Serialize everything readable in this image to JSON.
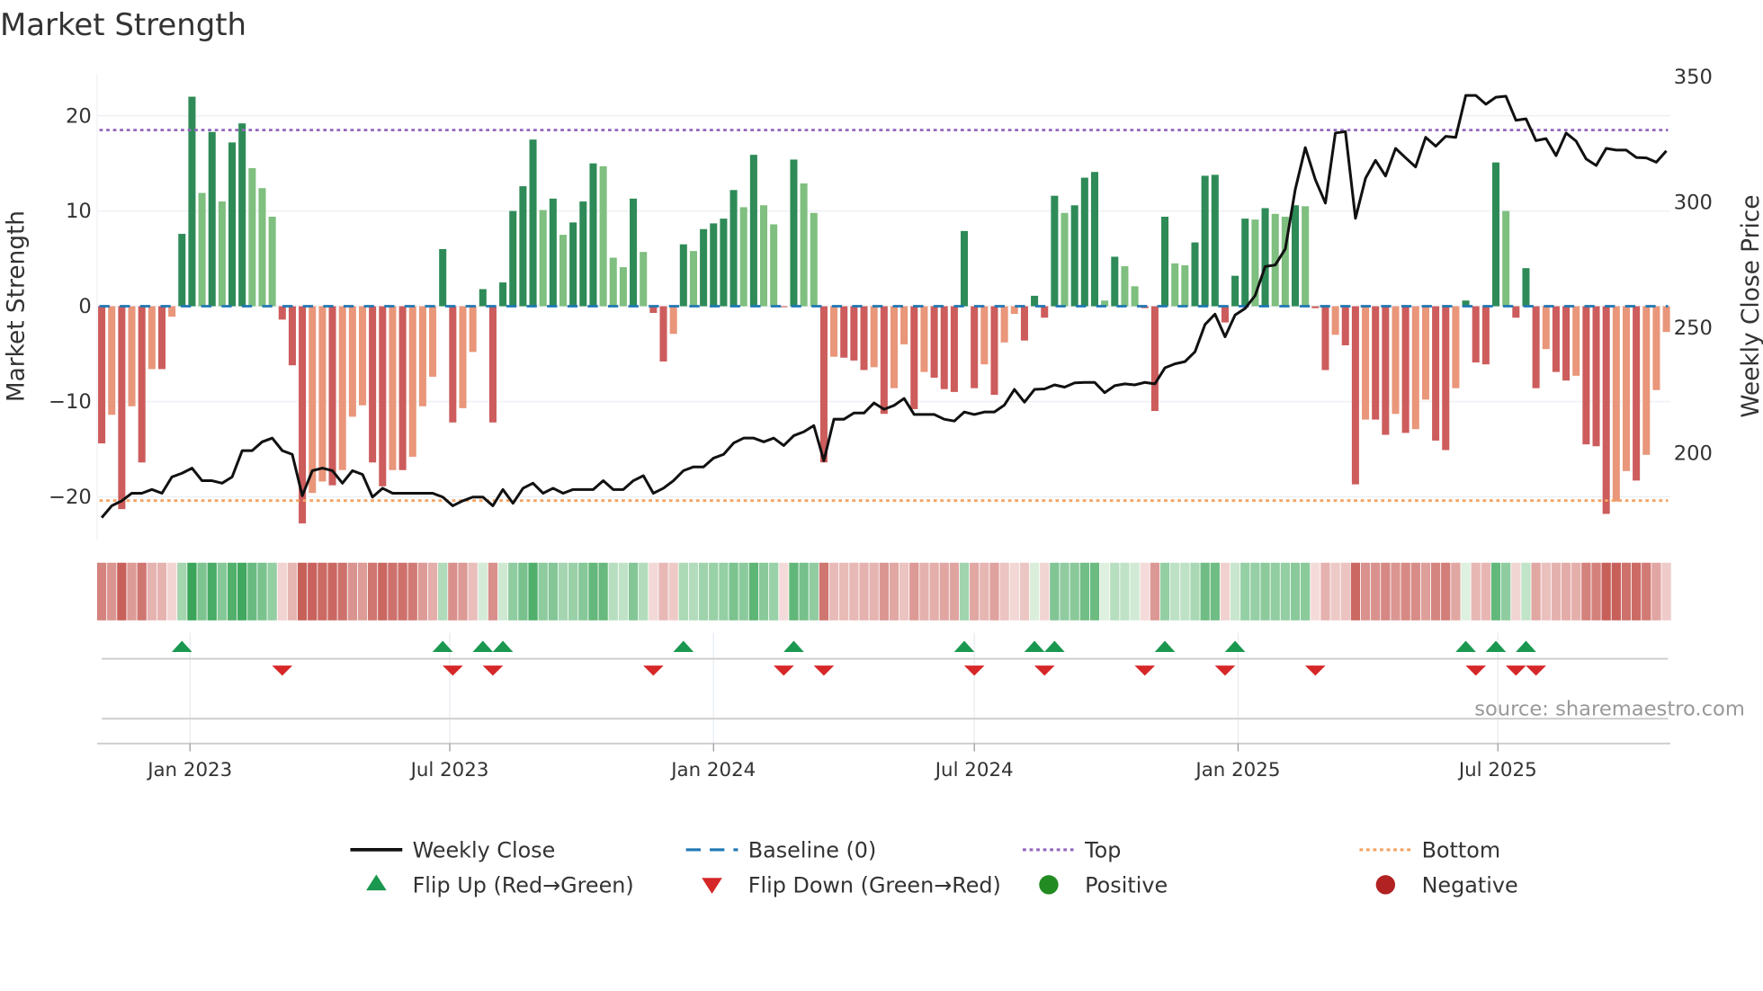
{
  "chart_data": {
    "type": "bar",
    "title": "Market Strength",
    "ylabel": "Market Strength",
    "y2label": "Weekly Close Price",
    "ylim": [
      -24.5,
      24.5
    ],
    "y2lim": [
      165.3,
      351.3
    ],
    "yticks": [
      20,
      10,
      0,
      -10,
      -20
    ],
    "ytick_labels": [
      "20",
      "10",
      "0",
      "−10",
      "−20"
    ],
    "y2ticks": [
      350,
      300,
      250,
      200
    ],
    "y2tick_labels": [
      "350",
      "300",
      "250",
      "200"
    ],
    "xticks": [
      {
        "label": "Jan 2023",
        "week_index": 8.8
      },
      {
        "label": "Jul 2023",
        "week_index": 34.7
      },
      {
        "label": "Jan 2024",
        "week_index": 61.0
      },
      {
        "label": "Jul 2024",
        "week_index": 87.0
      },
      {
        "label": "Jan 2025",
        "week_index": 113.3
      },
      {
        "label": "Jul 2025",
        "week_index": 139.2
      }
    ],
    "grid": true,
    "top_level": 18.5,
    "bottom_level": -20.4,
    "baseline": 0,
    "strength": [
      -14.4,
      -11.4,
      -21.3,
      -10.5,
      -16.4,
      -6.6,
      -6.6,
      -1.1,
      7.6,
      22.0,
      11.9,
      18.3,
      11.0,
      17.2,
      19.2,
      14.5,
      12.4,
      9.4,
      -1.4,
      -6.2,
      -22.8,
      -19.6,
      -18.4,
      -18.8,
      -17.2,
      -11.6,
      -10.4,
      -16.4,
      -18.9,
      -17.2,
      -17.2,
      -15.8,
      -10.5,
      -7.4,
      6.0,
      -12.2,
      -10.7,
      -4.8,
      1.8,
      -12.2,
      2.5,
      10.0,
      12.6,
      17.5,
      10.1,
      11.3,
      7.5,
      8.8,
      11.0,
      15.0,
      14.7,
      5.1,
      4.1,
      11.3,
      5.7,
      -0.7,
      -5.8,
      -2.9,
      6.5,
      5.8,
      8.1,
      8.7,
      9.2,
      12.2,
      10.4,
      15.9,
      10.6,
      8.6,
      -0.1,
      15.4,
      12.9,
      9.8,
      -16.4,
      -5.3,
      -5.4,
      -5.7,
      -6.7,
      -6.4,
      -11.3,
      -8.6,
      -4.0,
      -10.8,
      -6.9,
      -7.5,
      -8.7,
      -9.0,
      7.9,
      -8.6,
      -6.1,
      -9.3,
      -3.8,
      -0.8,
      -3.6,
      1.1,
      -1.2,
      11.6,
      9.8,
      10.6,
      13.5,
      14.1,
      0.6,
      5.2,
      4.2,
      2.1,
      -0.2,
      -11.0,
      9.4,
      4.5,
      4.3,
      6.7,
      13.7,
      13.8,
      -1.7,
      3.2,
      9.2,
      9.1,
      10.3,
      9.7,
      9.4,
      10.6,
      10.5,
      -0.2,
      -6.7,
      -3.0,
      -4.1,
      -18.7,
      -11.9,
      -11.9,
      -13.5,
      -11.3,
      -13.3,
      -12.9,
      -9.8,
      -14.1,
      -15.1,
      -8.6,
      0.6,
      -5.9,
      -6.1,
      15.1,
      10.0,
      -1.2,
      4.0,
      -8.6,
      -4.5,
      -6.9,
      -7.8,
      -7.3,
      -14.5,
      -14.7,
      -21.8,
      -20.5,
      -17.3,
      -18.3,
      -15.6,
      -8.8,
      -2.7
    ],
    "weekly_close": [
      174.3,
      179,
      181,
      184,
      184,
      185.5,
      184,
      190.5,
      192,
      194,
      189,
      189,
      188,
      190.5,
      201,
      201,
      204.5,
      206,
      201,
      199.5,
      183,
      193,
      194,
      193,
      188,
      193,
      191.5,
      182.5,
      186,
      184,
      184,
      184,
      184,
      184,
      182.5,
      179,
      181,
      182.5,
      182.5,
      179,
      185.5,
      180,
      186,
      188,
      184,
      186,
      184,
      185.5,
      185.5,
      185.5,
      189,
      185.5,
      185.5,
      189,
      191,
      184,
      186,
      189,
      193,
      194.5,
      194.5,
      198,
      199.5,
      204,
      206,
      206,
      204.5,
      206,
      203,
      207,
      208.5,
      211,
      197,
      213.5,
      213.5,
      216,
      216,
      220,
      217.5,
      219,
      221.8,
      215.4,
      215.4,
      215.4,
      213.5,
      212.8,
      216.4,
      215.4,
      216.4,
      216.4,
      219.2,
      225.4,
      220.3,
      225.4,
      225.6,
      227.2,
      226.3,
      228,
      228.2,
      228.2,
      224.1,
      226.9,
      227.6,
      227.2,
      228.2,
      227.6,
      234,
      235.6,
      236.5,
      240.4,
      251.3,
      255.4,
      246.4,
      255.1,
      257.7,
      262.8,
      274.4,
      275,
      281.4,
      305.1,
      321.8,
      309,
      299.7,
      327.6,
      328.2,
      293.6,
      309.6,
      316.7,
      310.5,
      321.5,
      317.7,
      314.1,
      325.9,
      322.4,
      326.3,
      325.9,
      342.6,
      342.6,
      339.1,
      341.9,
      342.3,
      332.7,
      333.3,
      324.6,
      325.4,
      318.6,
      327.6,
      324.4,
      317.3,
      314.7,
      321.5,
      320.8,
      320.8,
      317.9,
      317.7,
      316,
      320.5
    ],
    "legend_position": "bottom",
    "legend": [
      {
        "label": "Weekly Close",
        "kind": "line",
        "color": "#111111"
      },
      {
        "label": "Baseline (0)",
        "kind": "dash",
        "color": "#1f77b4"
      },
      {
        "label": "Top",
        "kind": "dot",
        "color": "#9467bd"
      },
      {
        "label": "Bottom",
        "kind": "dot",
        "color": "#f4a261"
      },
      {
        "label": "Flip Up (Red→Green)",
        "kind": "tri-up",
        "color": "#1a9850"
      },
      {
        "label": "Flip Down (Green→Red)",
        "kind": "tri-down",
        "color": "#d62728"
      },
      {
        "label": "Positive",
        "kind": "circle",
        "color": "#228b22"
      },
      {
        "label": "Negative",
        "kind": "circle",
        "color": "#b22222"
      }
    ],
    "source": "source: sharemaestro.com",
    "colors": {
      "pos_rising": "#2e8b57",
      "pos_falling": "#7fbf7f",
      "neg_falling": "#cd5c5c",
      "neg_rising": "#e9967a",
      "baseline": "#1f77b4",
      "top": "#9467bd",
      "bottom": "#f4a261",
      "flip_up": "#1a9850",
      "flip_down": "#d62728"
    }
  }
}
